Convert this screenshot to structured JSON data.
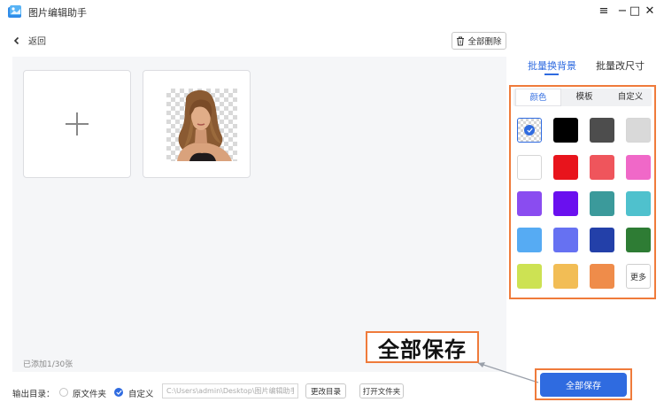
{
  "window": {
    "title": "图片编辑助手",
    "controls": {
      "menu": "≡",
      "minimize": "−",
      "maximize": "□",
      "close": "✕"
    }
  },
  "nav": {
    "back_label": "返回",
    "delete_all_label": "全部删除"
  },
  "workspace": {
    "added_count": "已添加1/30张"
  },
  "right_tabs": [
    {
      "label": "批量换背景",
      "active": true
    },
    {
      "label": "批量改尺寸",
      "active": false
    }
  ],
  "sub_tabs": [
    {
      "label": "颜色",
      "active": true
    },
    {
      "label": "模板",
      "active": false
    },
    {
      "label": "自定义",
      "active": false
    }
  ],
  "swatches": [
    "transparent",
    "#000000",
    "#4d4d4d",
    "#d9d9d9",
    "#ffffff",
    "#e8141c",
    "#ef555c",
    "#f068c8",
    "#8a4cf0",
    "#6a10ef",
    "#3b9a9b",
    "#4fc1cd",
    "#56abf3",
    "#6671f2",
    "#2340a9",
    "#2e7c34",
    "#cde253",
    "#f2bd55",
    "#ef8c4a"
  ],
  "more_label": "更多",
  "selected_swatch_index": 0,
  "bottom": {
    "output_label": "输出目录：",
    "option_original": "原文件夹",
    "option_custom": "自定义",
    "path_value": "C:\\Users\\admin\\Desktop\\图片编辑助手",
    "change_dir_label": "更改目录",
    "open_folder_label": "打开文件夹",
    "save_all_label": "全部保存"
  },
  "callout": {
    "text": "全部保存"
  },
  "colors": {
    "accent": "#2f6be0",
    "highlight": "#ef7b3b"
  }
}
